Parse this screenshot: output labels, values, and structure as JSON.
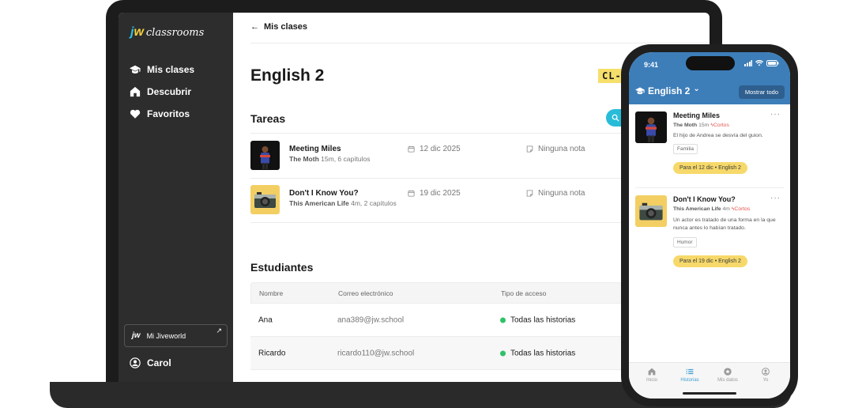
{
  "sidebar": {
    "logo_mark_j": "j",
    "logo_mark_w": "w",
    "logo_text": "classrooms",
    "items": [
      {
        "label": "Mis clases",
        "icon": "graduation-cap-icon"
      },
      {
        "label": "Descubrir",
        "icon": "home-icon"
      },
      {
        "label": "Favoritos",
        "icon": "heart-icon"
      }
    ],
    "jiveworld_mark": "jw",
    "jiveworld_label": "Mi Jiveworld",
    "jiveworld_arrow": "↗",
    "user": "Carol"
  },
  "main": {
    "back_label": "Mis clases",
    "back_arrow": "←",
    "class_title": "English 2",
    "class_code": "CL-G",
    "tasks_heading": "Tareas",
    "tasks": [
      {
        "title": "Meeting Miles",
        "source": "The Moth",
        "meta": "15m, 6 capítulos",
        "date": "12 dic 2025",
        "note": "Ninguna nota"
      },
      {
        "title": "Don't I Know You?",
        "source": "This American Life",
        "meta": "4m, 2 capítulos",
        "date": "19 dic 2025",
        "note": "Ninguna nota"
      }
    ],
    "students_heading": "Estudiantes",
    "students_columns": [
      "Nombre",
      "Correo electrónico",
      "Tipo de acceso"
    ],
    "students": [
      {
        "name": "Ana",
        "email": "ana389@jw.school",
        "access": "Todas las historias"
      },
      {
        "name": "Ricardo",
        "email": "ricardo110@jw.school",
        "access": "Todas las historias"
      }
    ]
  },
  "phone": {
    "time": "9:41",
    "class_label": "English 2",
    "chevron": "⌄",
    "show_all": "Mostrar todo",
    "menu_dots": "···",
    "cards": [
      {
        "title": "Meeting Miles",
        "source": "The Moth",
        "duration": "15m",
        "type": "Cortos",
        "description": "El hijo de Andrea se desvía del guion.",
        "tag": "Familia",
        "due": "Para el 12 dic • English 2"
      },
      {
        "title": "Don't I Know You?",
        "source": "This American Life",
        "duration": "4m",
        "type": "Cortos",
        "description": "Un actor es tratado de una forma en la que nunca antes lo habían tratado.",
        "tag": "Humor",
        "due": "Para el 19 dic • English 2"
      }
    ],
    "tabs": [
      {
        "label": "Inicio",
        "active": false
      },
      {
        "label": "Historias",
        "active": true
      },
      {
        "label": "Mis datos",
        "active": false
      },
      {
        "label": "Yo",
        "active": false
      }
    ]
  },
  "colors": {
    "sidebar": "#2d2d2d",
    "accent_cyan": "#28bcd9",
    "phone_header": "#3d7eb9",
    "code_highlight": "#f6df6a",
    "status_green": "#2ec167"
  }
}
